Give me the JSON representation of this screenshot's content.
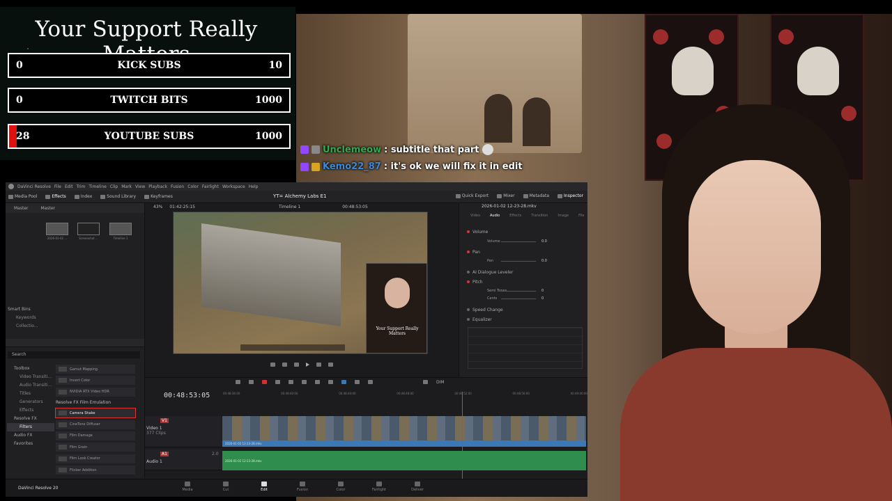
{
  "overlay": {
    "title": "Your Support Really Matters",
    "goals": [
      {
        "current": "0",
        "label": "KICK SUBS",
        "target": "10",
        "fraction": 0
      },
      {
        "current": "0",
        "label": "TWITCH BITS",
        "target": "1000",
        "fraction": 0
      },
      {
        "current": "28",
        "label": "YOUTUBE SUBS",
        "target": "1000",
        "fraction": 0.028
      }
    ]
  },
  "chat": [
    {
      "user": "Unclemeow",
      "message": ": subtitle that part",
      "user_color": "#34a853"
    },
    {
      "user": "Kemo22_87",
      "message": ": it's ok we will fix it in edit",
      "user_color": "#3b8ad9"
    }
  ],
  "resolve": {
    "menu": [
      "DaVinci Resolve",
      "File",
      "Edit",
      "Trim",
      "Timeline",
      "Clip",
      "Mark",
      "View",
      "Playback",
      "Fusion",
      "Color",
      "Fairlight",
      "Workspace",
      "Help"
    ],
    "toolbar": {
      "left": [
        "Media Pool",
        "Effects",
        "Index",
        "Sound Library",
        "Keyframes"
      ],
      "project_title": "YT= Alchemy Labs E1",
      "right": [
        "Quick Export",
        "Mixer",
        "Metadata",
        "Inspector"
      ]
    },
    "media_pool": {
      "tabs": [
        "Master",
        "Master"
      ],
      "clips": [
        "2026-01-02 ...",
        "Screenshot ...",
        "Timeline 1"
      ],
      "smart_bins": "Smart Bins",
      "smart_items": [
        "Keywords",
        "Collectio..."
      ]
    },
    "effects": {
      "search_placeholder": "Search",
      "tree": [
        "Toolbox",
        "Video Transiti...",
        "Audio Transiti...",
        "Titles",
        "Generators",
        "Effects",
        "Resolve FX",
        "Filters",
        "Audio FX",
        "Favorites"
      ],
      "list_top": [
        "Gamut Mapping",
        "Invert Color",
        "NVIDIA RTX Video HDR"
      ],
      "group": "Resolve FX Film Emulation",
      "list": [
        "Camera Shake",
        "CineTone Diffuser",
        "Film Damage",
        "Film Grain",
        "Film Look Creator",
        "Flicker Addition"
      ]
    },
    "viewer": {
      "zoom": "43%",
      "timecode": "01:42:25:15",
      "timeline_name": "Timeline 1",
      "current_time": "00:48:53:05",
      "pip_text": "Your Support Really Matters"
    },
    "inspector": {
      "file": "2026-01-02 12-23-28.mkv",
      "tabs": [
        "Video",
        "Audio",
        "Effects",
        "Transition",
        "Image",
        "File"
      ],
      "volume": "Volume",
      "volume_param": "Volume",
      "volume_val": "0.0",
      "pan": "Pan",
      "pan_param": "Pan",
      "pan_val": "0.0",
      "dialogue": "AI Dialogue Leveler",
      "pitch": "Pitch",
      "semitones": "Semi Tones",
      "semitones_val": "0",
      "cents": "Cents",
      "cents_val": "0",
      "speed": "Speed Change",
      "eq": "Equalizer"
    },
    "timeline": {
      "timecode": "00:48:53:05",
      "ruler": [
        "00:48:36:00",
        "00:48:40:00",
        "00:48:44:00",
        "00:48:48:00",
        "00:48:52:00",
        "00:48:56:00",
        "00:49:00:00"
      ],
      "video_track": "V1",
      "video_track_name": "Video 1",
      "video_clips": "377 Clips",
      "video_clip_name": "2026-01-02 12-23-28.mkv",
      "audio_track": "A1",
      "audio_track_name": "Audio 1",
      "audio_gain": "2.0",
      "audio_clip_name": "2026-01-02 12-23-28.mkv",
      "audio_meter": "DIM"
    },
    "bottom": {
      "brand": "DaVinci Resolve 20",
      "pages": [
        "Media",
        "Cut",
        "Edit",
        "Fusion",
        "Color",
        "Fairlight",
        "Deliver"
      ],
      "active_page": "Edit"
    }
  }
}
